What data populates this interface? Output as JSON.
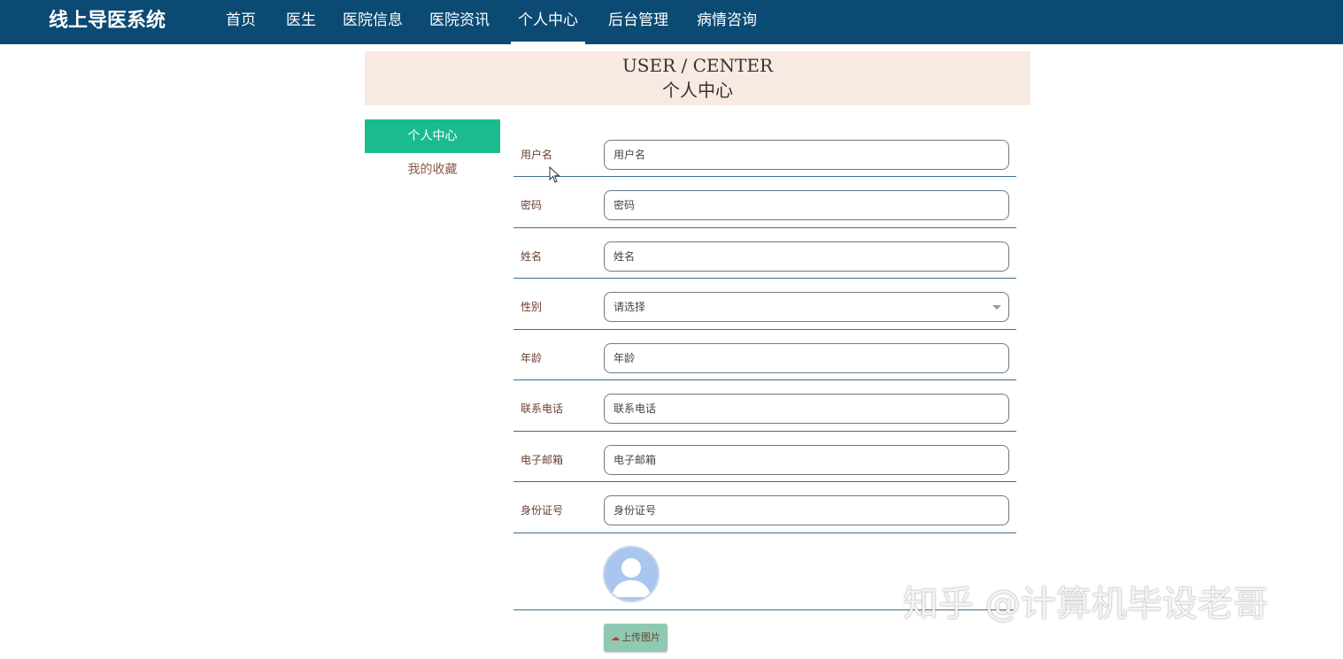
{
  "brand": "线上导医系统",
  "nav": [
    {
      "label": "首页"
    },
    {
      "label": "医生"
    },
    {
      "label": "医院信息"
    },
    {
      "label": "医院资讯"
    },
    {
      "label": "个人中心"
    },
    {
      "label": "后台管理"
    },
    {
      "label": "病情咨询"
    }
  ],
  "banner": {
    "en": "USER / CENTER",
    "cn": "个人中心"
  },
  "sidebar": {
    "active": "个人中心",
    "item": "我的收藏"
  },
  "form": {
    "username": {
      "label": "用户名",
      "placeholder": "用户名"
    },
    "password": {
      "label": "密码",
      "placeholder": "密码"
    },
    "name": {
      "label": "姓名",
      "placeholder": "姓名"
    },
    "gender": {
      "label": "性别",
      "value": "请选择"
    },
    "age": {
      "label": "年龄",
      "placeholder": "年龄"
    },
    "phone": {
      "label": "联系电话",
      "placeholder": "联系电话"
    },
    "email": {
      "label": "电子邮箱",
      "placeholder": "电子邮箱"
    },
    "idcard": {
      "label": "身份证号",
      "placeholder": "身份证号"
    }
  },
  "upload_label": "上传图片",
  "watermark": "知乎 @计算机毕设老哥",
  "colors": {
    "nav_bg": "#0b4a73",
    "active_green": "#1abc8f",
    "banner_bg": "#f8e9e2",
    "upload_bg": "#8fc9b2"
  },
  "icons": {
    "avatar": "user-avatar-icon",
    "upload": "cloud-upload-icon",
    "caret": "chevron-down-icon"
  }
}
